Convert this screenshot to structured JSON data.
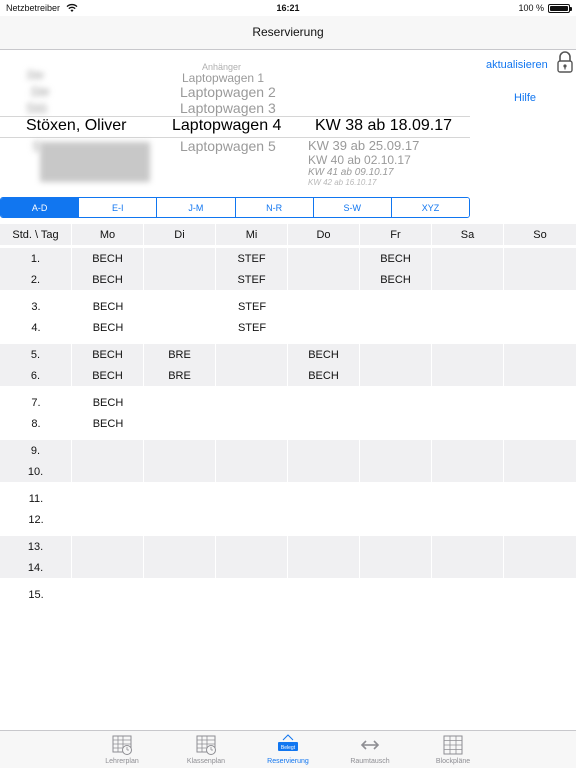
{
  "status_bar": {
    "carrier": "Netzbetreiber",
    "time": "16:21",
    "battery": "100 %"
  },
  "nav": {
    "title": "Reservierung"
  },
  "actions": {
    "refresh": "aktualisieren",
    "help": "Hilfe"
  },
  "picker": {
    "teacher": {
      "selected": "Stöxen, Oliver",
      "above": [
        "Ste",
        "Ste",
        "Stö"
      ],
      "below": [
        "S"
      ]
    },
    "device": {
      "above": [
        "Anhänger",
        "Laptopwagen 1",
        "Laptopwagen 2",
        "Laptopwagen 3"
      ],
      "selected": "Laptopwagen 4",
      "below": [
        "Laptopwagen 5"
      ]
    },
    "week": {
      "selected": "KW 38 ab 18.09.17",
      "below": [
        "KW 39 ab 25.09.17",
        "KW 40 ab 02.10.17",
        "KW 41 ab 09.10.17",
        "KW 42 ab 16.10.17"
      ]
    }
  },
  "segments": [
    "A-D",
    "E-I",
    "J-M",
    "N-R",
    "S-W",
    "XYZ"
  ],
  "segments_selected": "A-D",
  "table": {
    "headers": [
      "Std. \\ Tag",
      "Mo",
      "Di",
      "Mi",
      "Do",
      "Fr",
      "Sa",
      "So"
    ],
    "rows": [
      [
        "1.",
        "BECH",
        "",
        "STEF",
        "",
        "BECH",
        "",
        ""
      ],
      [
        "2.",
        "BECH",
        "",
        "STEF",
        "",
        "BECH",
        "",
        ""
      ],
      [
        "3.",
        "BECH",
        "",
        "STEF",
        "",
        "",
        "",
        ""
      ],
      [
        "4.",
        "BECH",
        "",
        "STEF",
        "",
        "",
        "",
        ""
      ],
      [
        "5.",
        "BECH",
        "BRE",
        "",
        "BECH",
        "",
        "",
        ""
      ],
      [
        "6.",
        "BECH",
        "BRE",
        "",
        "BECH",
        "",
        "",
        ""
      ],
      [
        "7.",
        "BECH",
        "",
        "",
        "",
        "",
        "",
        ""
      ],
      [
        "8.",
        "BECH",
        "",
        "",
        "",
        "",
        "",
        ""
      ],
      [
        "9.",
        "",
        "",
        "",
        "",
        "",
        "",
        ""
      ],
      [
        "10.",
        "",
        "",
        "",
        "",
        "",
        "",
        ""
      ],
      [
        "11.",
        "",
        "",
        "",
        "",
        "",
        "",
        ""
      ],
      [
        "12.",
        "",
        "",
        "",
        "",
        "",
        "",
        ""
      ],
      [
        "13.",
        "",
        "",
        "",
        "",
        "",
        "",
        ""
      ],
      [
        "14.",
        "",
        "",
        "",
        "",
        "",
        "",
        ""
      ],
      [
        "15.",
        "",
        "",
        "",
        "",
        "",
        "",
        ""
      ]
    ]
  },
  "tabs": [
    {
      "label": "Lehrerplan",
      "icon": "grid-clock-icon"
    },
    {
      "label": "Klassenplan",
      "icon": "grid-clock-icon"
    },
    {
      "label": "Reservierung",
      "icon": "belegt-icon",
      "badge": "Belegt",
      "active": true
    },
    {
      "label": "Raumtausch",
      "icon": "swap-arrows-icon"
    },
    {
      "label": "Blockpläne",
      "icon": "grid-icon"
    }
  ],
  "colors": {
    "accent": "#1176f0",
    "row_shade": "#f0f0f2",
    "inactive_tab": "#8e8e93"
  }
}
